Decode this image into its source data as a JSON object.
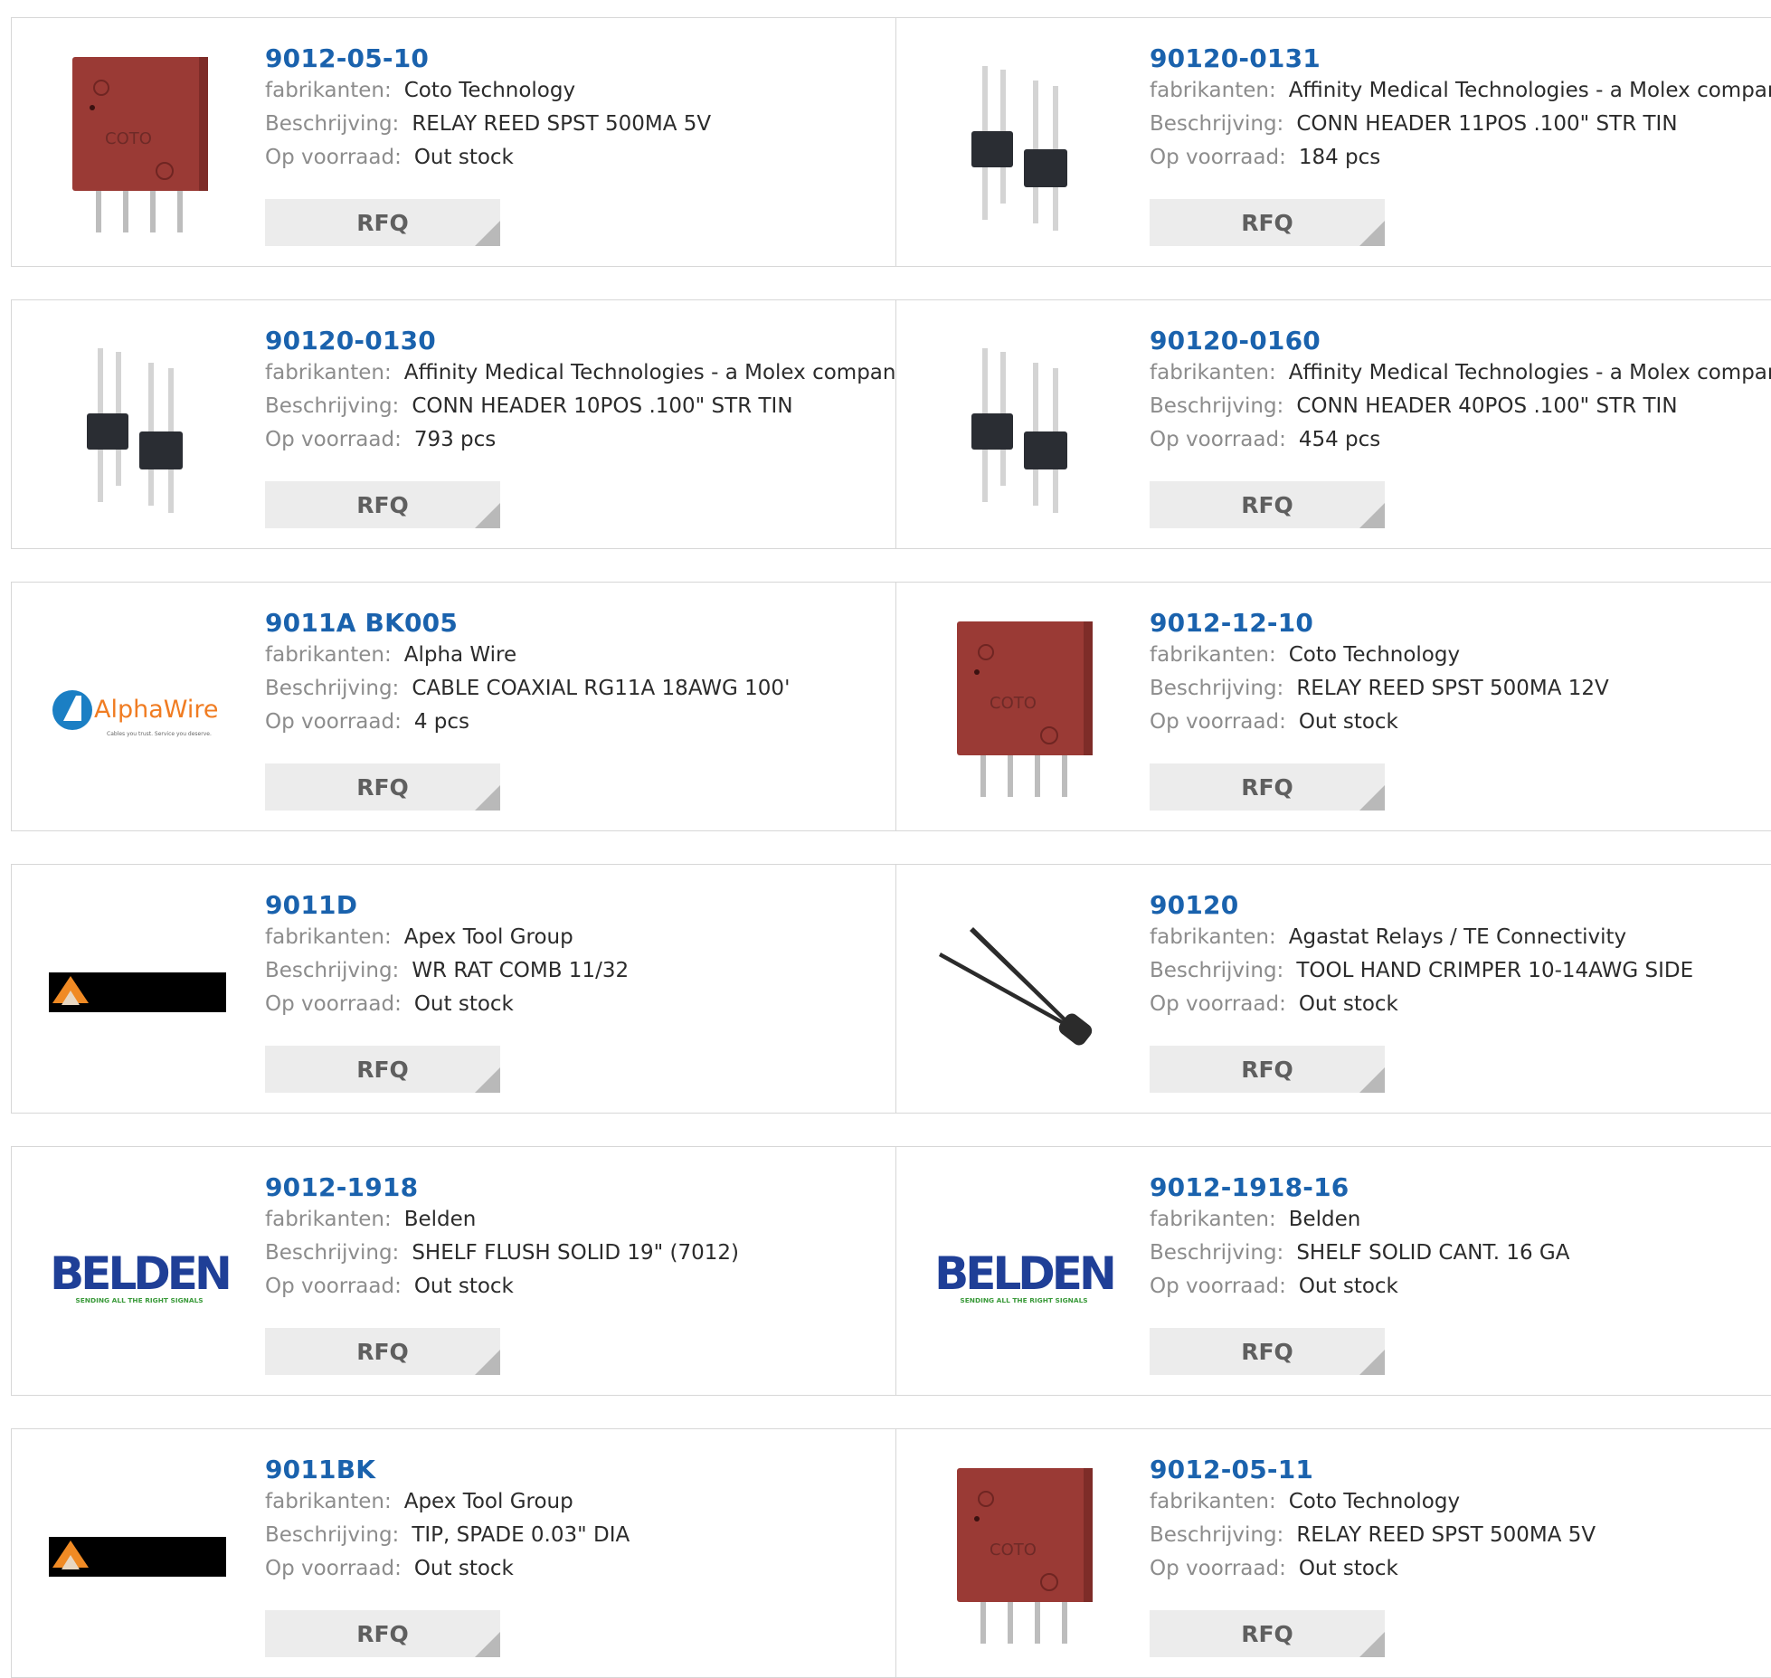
{
  "labels": {
    "manufacturer": "fabrikanten:",
    "description": "Beschrijving:",
    "stock": "Op voorraad:",
    "rfq": "RFQ"
  },
  "products": [
    {
      "part": "9012-05-10",
      "manufacturer": "Coto Technology",
      "description": "RELAY REED SPST 500MA 5V",
      "stock": "Out stock",
      "image": "relay",
      "image_text": "COTO"
    },
    {
      "part": "90120-0131",
      "manufacturer": "Affinity Medical Technologies - a Molex company",
      "description": "CONN HEADER 11POS .100\" STR TIN",
      "stock": "184 pcs",
      "image": "header"
    },
    {
      "part": "90120-0130",
      "manufacturer": "Affinity Medical Technologies - a Molex company",
      "description": "CONN HEADER 10POS .100\" STR TIN",
      "stock": "793 pcs",
      "image": "header"
    },
    {
      "part": "90120-0160",
      "manufacturer": "Affinity Medical Technologies - a Molex company",
      "description": "CONN HEADER 40POS .100\" STR TIN",
      "stock": "454 pcs",
      "image": "header"
    },
    {
      "part": "9011A BK005",
      "manufacturer": "Alpha Wire",
      "description": "CABLE COAXIAL RG11A 18AWG 100'",
      "stock": "4 pcs",
      "image": "alphawire",
      "image_text": "AlphaWire",
      "image_subtext": "Cables you trust. Service you deserve."
    },
    {
      "part": "9012-12-10",
      "manufacturer": "Coto Technology",
      "description": "RELAY REED SPST 500MA 12V",
      "stock": "Out stock",
      "image": "relay",
      "image_text": "COTO"
    },
    {
      "part": "9011D",
      "manufacturer": "Apex Tool Group",
      "description": "WR RAT COMB 11/32",
      "stock": "Out stock",
      "image": "apex"
    },
    {
      "part": "90120",
      "manufacturer": "Agastat Relays / TE Connectivity",
      "description": "TOOL HAND CRIMPER 10-14AWG SIDE",
      "stock": "Out stock",
      "image": "crimper"
    },
    {
      "part": "9012-1918",
      "manufacturer": "Belden",
      "description": "SHELF FLUSH SOLID 19\" (7012)",
      "stock": "Out stock",
      "image": "belden",
      "image_text": "BELDEN",
      "image_subtext": "SENDING ALL THE RIGHT SIGNALS"
    },
    {
      "part": "9012-1918-16",
      "manufacturer": "Belden",
      "description": "SHELF SOLID CANT. 16 GA",
      "stock": "Out stock",
      "image": "belden",
      "image_text": "BELDEN",
      "image_subtext": "SENDING ALL THE RIGHT SIGNALS"
    },
    {
      "part": "9011BK",
      "manufacturer": "Apex Tool Group",
      "description": "TIP, SPADE 0.03\" DIA",
      "stock": "Out stock",
      "image": "apex"
    },
    {
      "part": "9012-05-11",
      "manufacturer": "Coto Technology",
      "description": "RELAY REED SPST 500MA 5V",
      "stock": "Out stock",
      "image": "relay",
      "image_text": "COTO"
    }
  ],
  "colors": {
    "part_link": "#1a62ad",
    "label": "#8c8c8c",
    "value": "#2b2b2b",
    "rfq_bg": "#ececec",
    "border": "#d7d7d7",
    "relay_body": "#9a3a35",
    "alpha_blue": "#1b7fc4",
    "alpha_orange": "#f07c22",
    "belden_blue": "#1f3f97",
    "belden_green": "#3a9a3a"
  }
}
